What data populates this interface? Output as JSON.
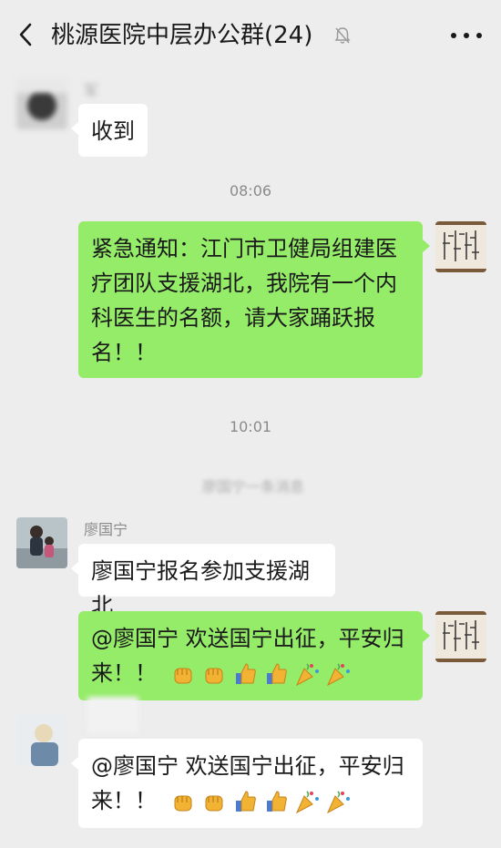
{
  "header": {
    "title": "桃源医院中层办公群(24)"
  },
  "messages": {
    "m1": {
      "sender": "军",
      "text": "收到"
    },
    "time1": "08:06",
    "m2": {
      "text": "紧急通知：江门市卫健局组建医疗团队支援湖北，我院有一个内科医生的名额，请大家踊跃报名！！"
    },
    "time2": "10:01",
    "system": "廖国宁一条消息",
    "m3": {
      "sender": "廖国宁",
      "text": "廖国宁报名参加支援湖北"
    },
    "m4": {
      "text": "@廖国宁  欢送国宁出征，平安归来！！"
    },
    "m5": {
      "text": "@廖国宁  欢送国宁出征，平安归来！！"
    }
  },
  "icons": {
    "back": "chevron-left-icon",
    "mute": "bell-off-icon",
    "more": "more-dots-icon",
    "reactions": [
      "fist-icon",
      "fist-icon",
      "thumbs-up-icon",
      "thumbs-up-icon",
      "party-popper-icon",
      "party-popper-icon"
    ]
  },
  "colors": {
    "background": "#ededed",
    "bubble_self": "#95ec69",
    "bubble_other": "#ffffff",
    "meta_text": "#8a8a8a"
  }
}
